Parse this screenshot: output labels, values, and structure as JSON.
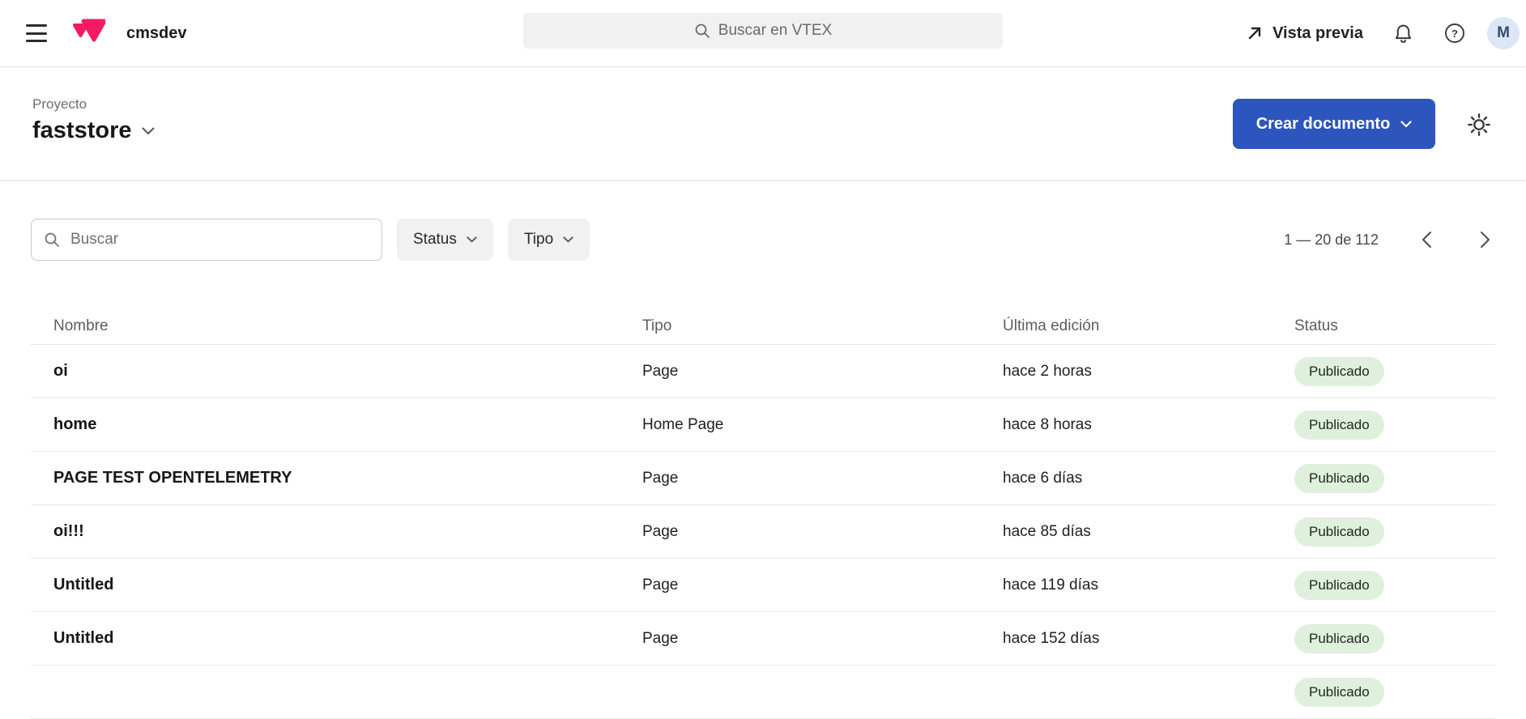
{
  "topbar": {
    "account": "cmsdev",
    "search_placeholder": "Buscar en VTEX",
    "preview_label": "Vista previa",
    "avatar_initial": "M"
  },
  "header": {
    "project_label": "Proyecto",
    "project_name": "faststore",
    "create_button_label": "Crear documento"
  },
  "filters": {
    "search_placeholder": "Buscar",
    "status_label": "Status",
    "tipo_label": "Tipo",
    "pagination_range": "1 — 20 de 112"
  },
  "table": {
    "columns": [
      "Nombre",
      "Tipo",
      "Última edición",
      "Status"
    ],
    "rows": [
      {
        "name": "oi",
        "type": "Page",
        "edited": "hace 2 horas",
        "status": "Publicado"
      },
      {
        "name": "home",
        "type": "Home Page",
        "edited": "hace 8 horas",
        "status": "Publicado"
      },
      {
        "name": "PAGE TEST OPENTELEMETRY",
        "type": "Page",
        "edited": "hace 6 días",
        "status": "Publicado"
      },
      {
        "name": "oi!!!",
        "type": "Page",
        "edited": "hace 85 días",
        "status": "Publicado"
      },
      {
        "name": "Untitled",
        "type": "Page",
        "edited": "hace 119 días",
        "status": "Publicado"
      },
      {
        "name": "Untitled",
        "type": "Page",
        "edited": "hace 152 días",
        "status": "Publicado"
      }
    ],
    "partial_row": {
      "status": "Publicado"
    }
  },
  "icons": {
    "menu": "hamburger-icon",
    "logo": "vtex-logo",
    "search": "search-icon",
    "preview": "arrow-up-right-icon",
    "notifications": "bell-icon",
    "help": "question-circle-icon",
    "settings": "gear-icon",
    "chevron_down": "chevron-down-icon",
    "prev": "chevron-left-icon",
    "next": "chevron-right-icon"
  },
  "colors": {
    "primary_button": "#2d55be",
    "logo_pink": "#f71963",
    "badge_bg": "#dff0dc",
    "badge_text": "#212921",
    "avatar_bg": "#dbe7f6",
    "avatar_text": "#3c4a66",
    "muted_text": "#6e6e71",
    "border": "#e2e2e4"
  }
}
